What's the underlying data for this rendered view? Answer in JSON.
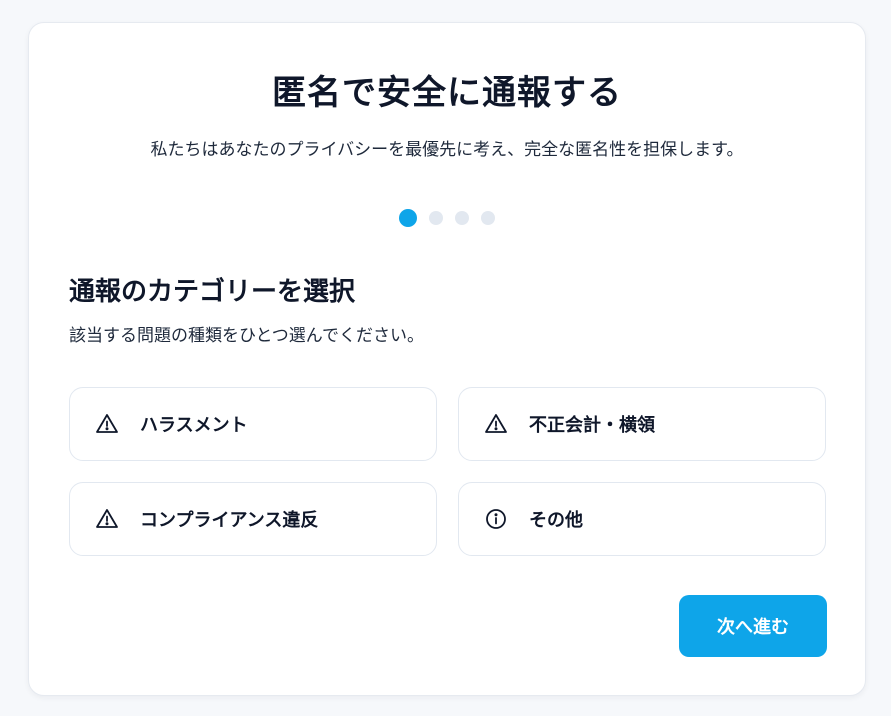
{
  "header": {
    "title": "匿名で安全に通報する",
    "subtitle": "私たちはあなたのプライバシーを最優先に考え、完全な匿名性を担保します。"
  },
  "stepper": {
    "current_step": 1,
    "total_steps": 4
  },
  "section": {
    "title": "通報のカテゴリーを選択",
    "description": "該当する問題の種類をひとつ選んでください。"
  },
  "categories": [
    {
      "label": "ハラスメント",
      "icon": "warning-icon"
    },
    {
      "label": "不正会計・横領",
      "icon": "warning-icon"
    },
    {
      "label": "コンプライアンス違反",
      "icon": "warning-icon"
    },
    {
      "label": "その他",
      "icon": "info-icon"
    }
  ],
  "actions": {
    "next_label": "次へ進む"
  },
  "colors": {
    "accent": "#0ea5e9",
    "dot_inactive": "#e2e8f0",
    "border": "#e2e8f0",
    "text": "#0f172a"
  }
}
